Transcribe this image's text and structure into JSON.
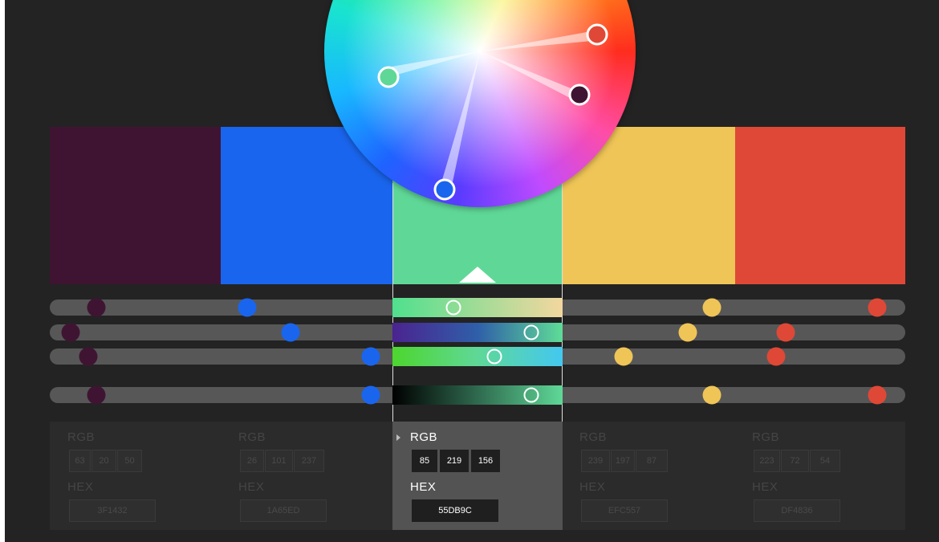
{
  "swatches": [
    {
      "name": "swatch-1",
      "hex": "3F1432",
      "rgb": [
        "63",
        "20",
        "50"
      ],
      "color": "#3f1432"
    },
    {
      "name": "swatch-2",
      "hex": "1A65ED",
      "rgb": [
        "26",
        "101",
        "237"
      ],
      "color": "#1a65ed"
    },
    {
      "name": "swatch-3",
      "hex": "55DB9C",
      "rgb": [
        "85",
        "219",
        "156"
      ],
      "color": "#5fd897"
    },
    {
      "name": "swatch-4",
      "hex": "EFC557",
      "rgb": [
        "239",
        "197",
        "87"
      ],
      "color": "#efc557"
    },
    {
      "name": "swatch-5",
      "hex": "DF4836",
      "rgb": [
        "223",
        "72",
        "54"
      ],
      "color": "#df4836"
    }
  ],
  "selected_index": 2,
  "labels": {
    "rgb": "RGB",
    "hex": "HEX"
  },
  "colors": {
    "background": "#232323",
    "track": "#575757",
    "panel": "#2b2b2b",
    "panel_selected": "#535353"
  },
  "sliders": [
    {
      "row": "slider-1",
      "values": [
        0.055,
        0.232,
        0.48,
        0.78,
        0.97
      ]
    },
    {
      "row": "slider-2",
      "values": [
        0.025,
        0.28,
        0.57,
        0.75,
        0.855
      ]
    },
    {
      "row": "slider-3",
      "values": [
        0.04,
        0.375,
        0.52,
        0.67,
        0.84
      ]
    },
    {
      "row": "slider-4",
      "values": [
        0.055,
        0.375,
        0.57,
        0.78,
        0.97
      ]
    }
  ],
  "icons": {
    "collapse": "caret-right-icon",
    "active_marker": "triangle-up-icon"
  }
}
